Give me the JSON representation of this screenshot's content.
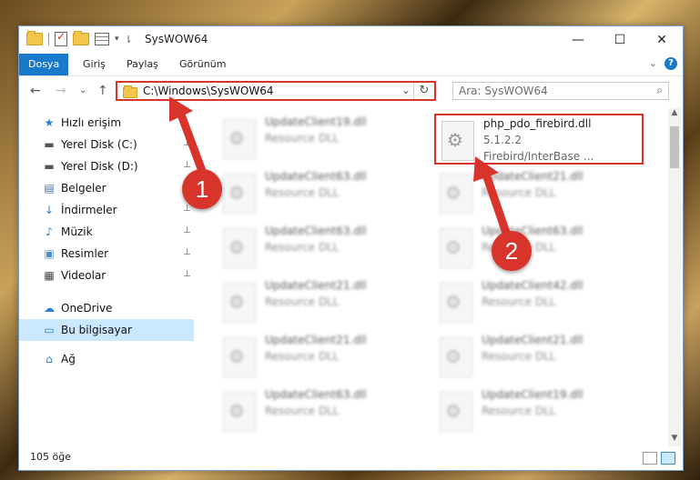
{
  "window": {
    "title": "SysWOW64",
    "minimize": "—",
    "maximize": "☐",
    "close": "✕"
  },
  "ribbon": {
    "tabs": [
      "Dosya",
      "Giriş",
      "Paylaş",
      "Görünüm"
    ],
    "expand": "⌄",
    "help": "?"
  },
  "nav": {
    "back": "←",
    "forward": "→",
    "recent": "⌄",
    "up": "↑",
    "address_path": "C:\\Windows\\SysWOW64",
    "address_dropdown": "⌄",
    "refresh": "↻",
    "search_placeholder": "Ara: SysWOW64",
    "search_icon": "⌕"
  },
  "sidebar": {
    "items": [
      {
        "label": "Hızlı erişim",
        "icon": "star-icon",
        "glyph": "★",
        "pinned": false
      },
      {
        "label": "Yerel Disk (C:)",
        "icon": "drive-icon",
        "glyph": "▬",
        "pinned": true
      },
      {
        "label": "Yerel Disk (D:)",
        "icon": "drive-icon",
        "glyph": "▬",
        "pinned": true
      },
      {
        "label": "Belgeler",
        "icon": "documents-icon",
        "glyph": "▤",
        "pinned": true
      },
      {
        "label": "İndirmeler",
        "icon": "downloads-icon",
        "glyph": "↓",
        "pinned": true
      },
      {
        "label": "Müzik",
        "icon": "music-icon",
        "glyph": "♪",
        "pinned": true
      },
      {
        "label": "Resimler",
        "icon": "pictures-icon",
        "glyph": "▣",
        "pinned": true
      },
      {
        "label": "Videolar",
        "icon": "videos-icon",
        "glyph": "▦",
        "pinned": true
      },
      {
        "label": "OneDrive",
        "icon": "onedrive-icon",
        "glyph": "☁",
        "pinned": false
      },
      {
        "label": "Bu bilgisayar",
        "icon": "computer-icon",
        "glyph": "▭",
        "pinned": false
      },
      {
        "label": "Ağ",
        "icon": "network-icon",
        "glyph": "⌂",
        "pinned": false
      }
    ],
    "pin_glyph": "📌"
  },
  "files": [
    {
      "name": "UpdateClient19.dll",
      "desc": "Resource DLL"
    },
    {
      "name": "php_pdo_firebird.dll",
      "version": "5.1.2.2",
      "desc": "Firebird/InterBase ..."
    },
    {
      "name": "UpdateClient63.dll",
      "desc": "Resource DLL"
    },
    {
      "name": "UpdateClient21.dll",
      "desc": "Resource DLL"
    },
    {
      "name": "UpdateClient63.dll",
      "desc": "Resource DLL"
    },
    {
      "name": "UpdateClient63.dll",
      "desc": "Resource DLL"
    },
    {
      "name": "UpdateClient21.dll",
      "desc": "Resource DLL"
    },
    {
      "name": "UpdateClient42.dll",
      "desc": "Resource DLL"
    },
    {
      "name": "UpdateClient21.dll",
      "desc": "Resource DLL"
    },
    {
      "name": "UpdateClient21.dll",
      "desc": "Resource DLL"
    },
    {
      "name": "UpdateClient63.dll",
      "desc": "Resource DLL"
    },
    {
      "name": "UpdateClient19.dll",
      "desc": "Resource DLL"
    }
  ],
  "status": {
    "count": "105 öğe"
  },
  "annotations": {
    "badge1": "1",
    "badge2": "2",
    "color": "#d9342b"
  }
}
